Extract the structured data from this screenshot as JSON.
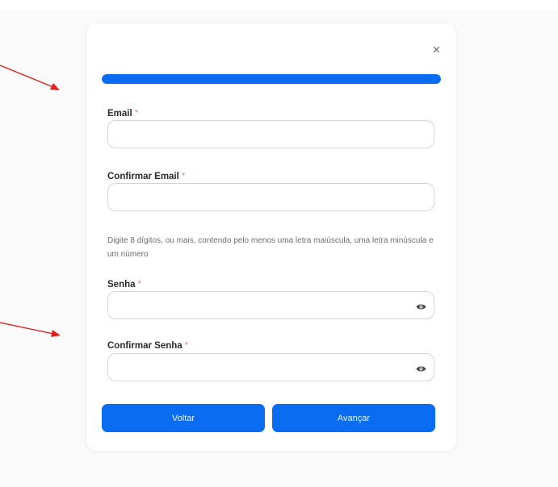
{
  "form": {
    "progress_fraction": 1.0,
    "fields": [
      {
        "label": "Email",
        "required_mark": "*",
        "value": "",
        "placeholder": ""
      },
      {
        "label": "Confirmar Email",
        "required_mark": "*",
        "value": "",
        "placeholder": ""
      },
      {
        "label": "Senha",
        "required_mark": "*",
        "value": "",
        "placeholder": ""
      },
      {
        "label": "Confirmar Senha",
        "required_mark": "*",
        "value": "",
        "placeholder": ""
      }
    ],
    "password_hint": "Digite 8 dígitos, ou mais, contendo pelo menos uma letra maiúscula, uma letra minúscula e um número",
    "back_label": "Voltar",
    "next_label": "Avançar"
  },
  "icons": {
    "close": "close-icon",
    "show_password": "eye-icon"
  },
  "colors": {
    "accent": "#0a6cf1",
    "required": "#f0837a",
    "annotation_arrow": "#e0201c"
  }
}
